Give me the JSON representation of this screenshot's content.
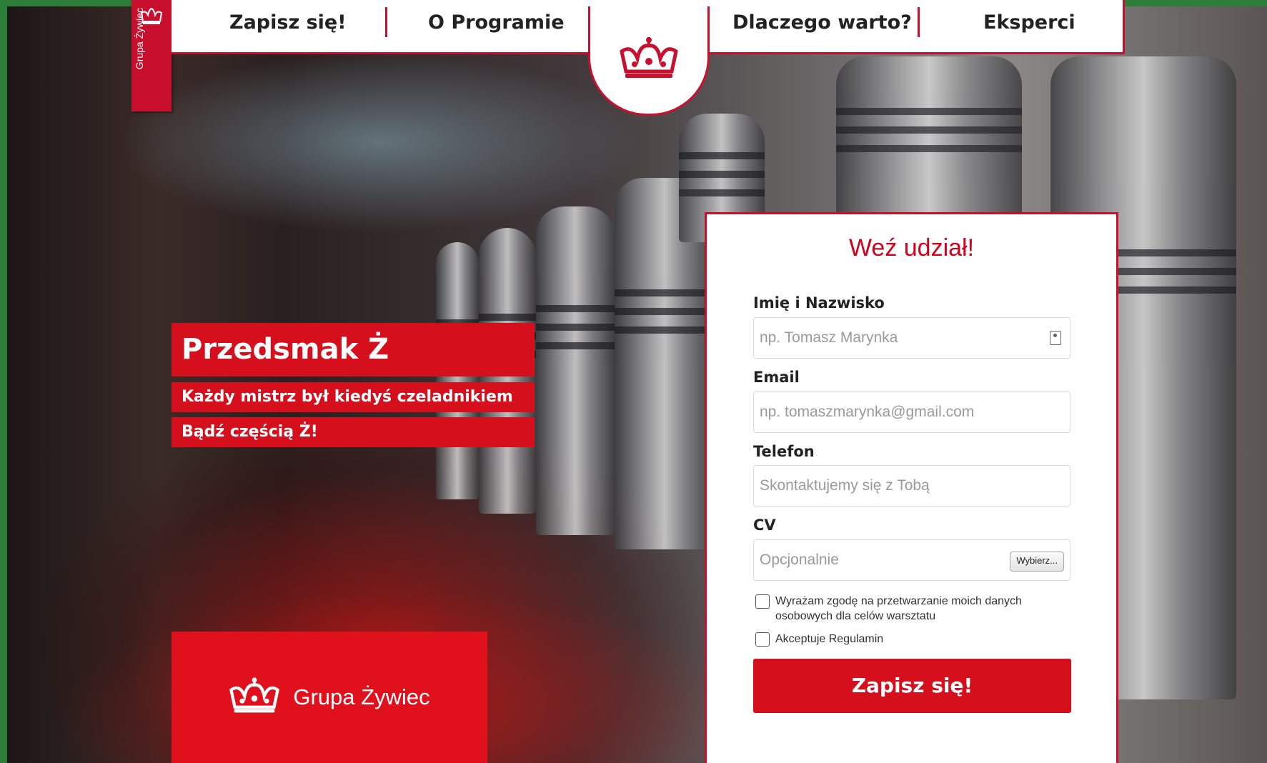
{
  "nav": {
    "items": [
      "Zapisz się!",
      "O Programie",
      "Dlaczego warto?",
      "Eksperci"
    ]
  },
  "brand": {
    "side_tag": "Grupa Żywiec",
    "logo_text": "Grupa Żywiec",
    "color": "#d50f1c"
  },
  "hero": {
    "title": "Przedsmak Ż",
    "line1": "Każdy mistrz był kiedyś czeladnikiem",
    "line2": "Bądź częścią Ż!"
  },
  "form": {
    "heading": "Weź udział!",
    "name": {
      "label": "Imię i Nazwisko",
      "placeholder": "np. Tomasz Marynka"
    },
    "email": {
      "label": "Email",
      "placeholder": "np. tomaszmarynka@gmail.com"
    },
    "phone": {
      "label": "Telefon",
      "placeholder": "Skontaktujemy się z Tobą"
    },
    "cv": {
      "label": "CV",
      "placeholder": "Opcjonalnie",
      "browse": "Wybierz..."
    },
    "consent1": "Wyrażam zgodę na przetwarzanie moich danych osobowych dla celów warsztatu",
    "consent2": "Akceptuje Regulamin",
    "submit": "Zapisz się!"
  }
}
